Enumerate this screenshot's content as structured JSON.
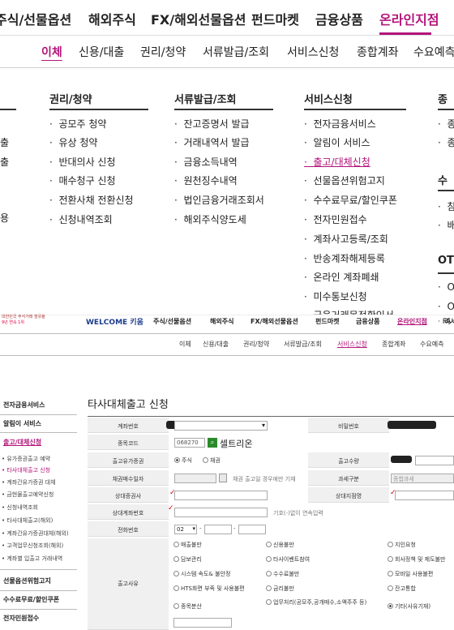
{
  "top_nav": {
    "items": [
      "주식/선물옵션",
      "해외주식",
      "FX/해외선물옵션",
      "펀드마켓",
      "금융상품",
      "온라인지점"
    ],
    "active_index": 5
  },
  "sub_nav": {
    "items": [
      "이체",
      "신용/대출",
      "권리/청약",
      "서류발급/조회",
      "서비스신청",
      "종합계좌",
      "수요예측"
    ],
    "active_index": 0
  },
  "mega_menu": {
    "left_stub_items": [
      "출",
      "출",
      "용"
    ],
    "columns": [
      {
        "title": "권리/청약",
        "items": [
          "공모주 청약",
          "유상 청약",
          "반대의사 신청",
          "매수청구 신청",
          "전환사채 전환신청",
          "신청내역조회"
        ]
      },
      {
        "title": "서류발급/조회",
        "items": [
          "잔고증명서 발급",
          "거래내역서 발급",
          "금융소득내역",
          "원천징수내역",
          "법인금융거래조회서",
          "해외주식양도세"
        ]
      },
      {
        "title": "서비스신청",
        "items": [
          "전자금융서비스",
          "알림이 서비스",
          "출고/대체신청",
          "선물옵션위험고지",
          "수수료무료/할인쿠폰",
          "전자민원접수",
          "계좌사고등록/조회",
          "반송계좌해제등록",
          "온라인 계좌폐쇄",
          "미수통보신청",
          "금융거래목적확인서"
        ],
        "highlight_index": 2
      }
    ],
    "right_stub": {
      "title": "종",
      "items": [
        "종",
        "종"
      ],
      "sub_title": "수",
      "sub_items": [
        "참",
        "배"
      ],
      "otp_title": "OTP",
      "otp_items": [
        "O",
        "O",
        "FA"
      ]
    }
  },
  "page2": {
    "logo_text_1": "대한민국 주식거래 점유율",
    "logo_text_2": "9년 연속 1위",
    "welcome": "WELCOME 키움",
    "top_items": [
      "주식/선물옵션",
      "해외주식",
      "FX/해외선물옵션",
      "펀드마켓",
      "금융상품",
      "온라인지점",
      "리서"
    ],
    "top_active": 5,
    "sub_items": [
      "이체",
      "신용/대출",
      "권리/청약",
      "서류발급/조회",
      "서비스신청",
      "종합계좌",
      "수요예측"
    ],
    "sub_active": 4,
    "left_menu": {
      "items_top": [
        "전자금융서비스",
        "알림이 서비스",
        "출고/대체신청"
      ],
      "sub_items": [
        "유가증권출고 예약",
        "타사대체출고 신청",
        "계좌간유가증권 대체",
        "금현물출고예약신청",
        "신청내역조회",
        "타사대체출고(해외)",
        "계좌간유가증권대체(해외)",
        "고객업무신청조회(해외)",
        "계좌별 입출고 거래내역"
      ],
      "items_bottom": [
        "선물옵션위험고지",
        "수수료무료/할인쿠폰",
        "전자민원접수"
      ]
    },
    "title": "타사대체출고 신청",
    "form": {
      "account_label": "계좌번호",
      "password_label": "비밀번호",
      "stock_code_label": "종목코드",
      "stock_code_value": "068270",
      "stock_name": "셀트리온",
      "qty_label": "출고수량",
      "type_label": "출고유가증권",
      "type_stock": "주식",
      "type_bond": "채권",
      "bond_date_label": "채권매수일자",
      "bond_note": "채권 출고일 경우에만 기재",
      "tax_label": "과세구분",
      "tax_value": "종합과세",
      "target_company_label": "상대증권사",
      "target_branch_label": "상대지점명",
      "target_account_label": "상대계좌번호",
      "target_account_note": "기호(-)없이 연속입력",
      "phone_label": "전화번호",
      "phone_prefix": "02",
      "reason_label": "출고사유",
      "reasons": [
        "매출불만",
        "신용불만",
        "지인요청",
        "담보관리",
        "타사이벤트참여",
        "회사정책 및 제도불만",
        "시스템 속도& 불안정",
        "수수료불만",
        "모바일 사용불편",
        "HTS화면 부족 및 사용불편",
        "금리불만",
        "잔고통합",
        "종목분산",
        "업무처리(공모주,공개매수,소액주주 등)",
        "기타(사유기재)"
      ],
      "reason_selected": 14
    }
  }
}
